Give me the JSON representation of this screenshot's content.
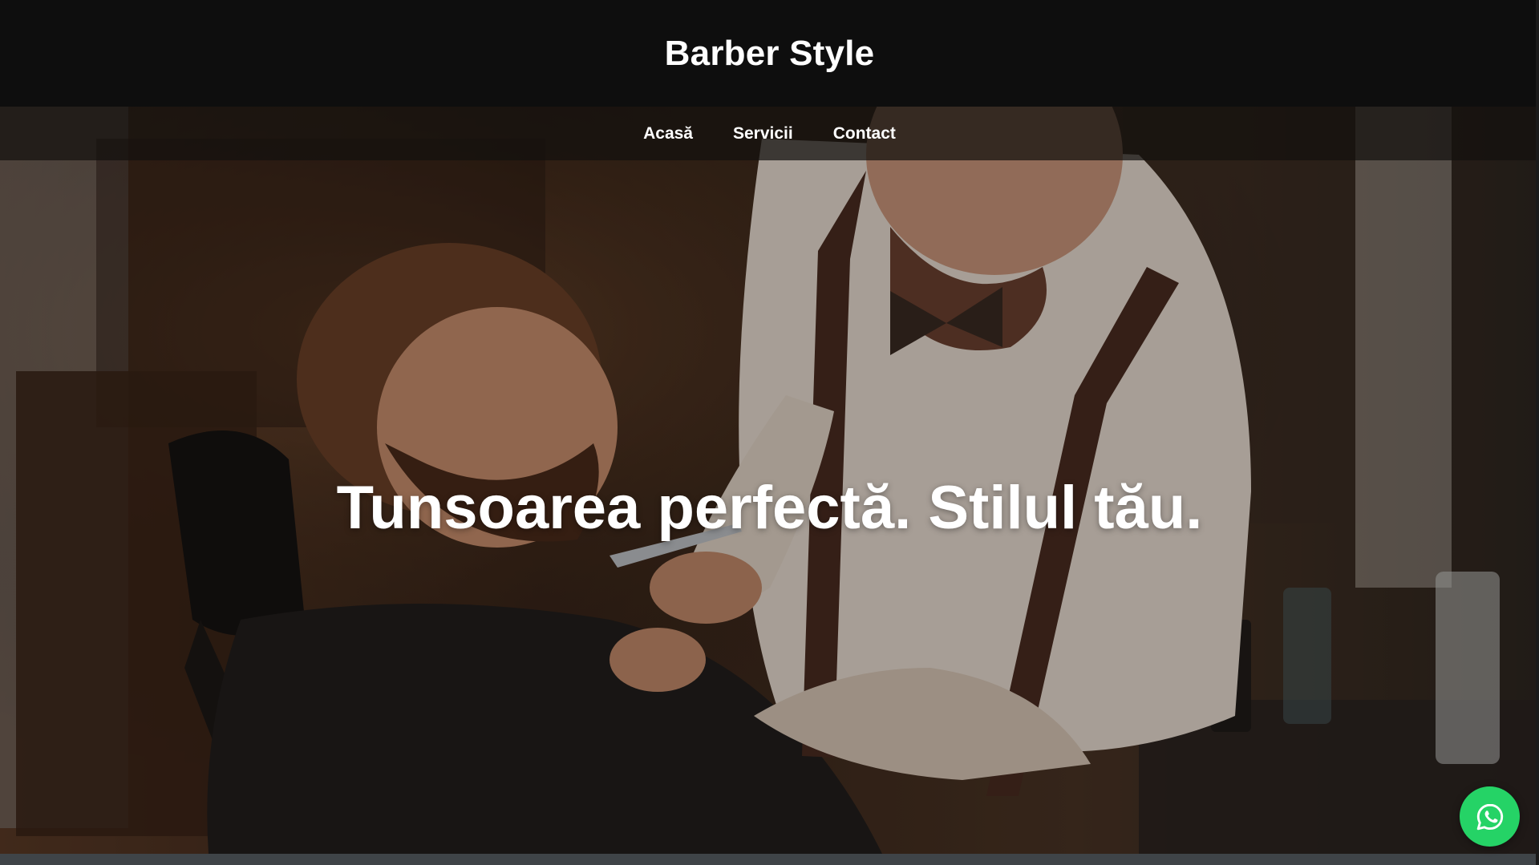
{
  "header": {
    "title": "Barber Style"
  },
  "nav": {
    "items": [
      {
        "label": "Acasă"
      },
      {
        "label": "Servicii"
      },
      {
        "label": "Contact"
      }
    ]
  },
  "hero": {
    "headline": "Tunsoarea perfectă. Stilul tău.",
    "image": "barber-trimming-beard-photo"
  },
  "floating": {
    "whatsapp_icon": "whatsapp-icon",
    "color": "#25d366"
  },
  "colors": {
    "header_bg": "#0e0e0e",
    "text": "#ffffff"
  }
}
